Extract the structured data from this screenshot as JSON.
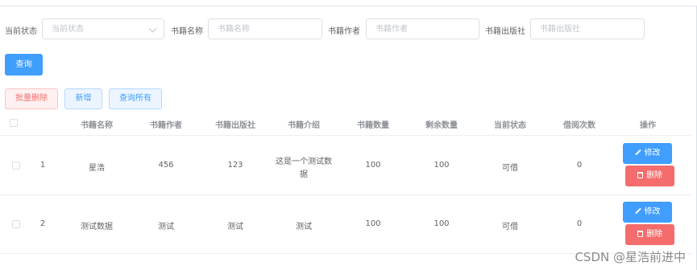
{
  "search": {
    "status_label": "当前状态",
    "status_placeholder": "当前状态",
    "name_label": "书籍名称",
    "name_placeholder": "书籍名称",
    "author_label": "书籍作者",
    "author_placeholder": "书籍作者",
    "publisher_label": "书籍出版社",
    "publisher_placeholder": "书籍出版社",
    "query_button": "查询"
  },
  "toolbar": {
    "batch_delete": "批量删除",
    "add": "新增",
    "query_all": "查询所有"
  },
  "table": {
    "headers": [
      "书籍名称",
      "书籍作者",
      "书籍出版社",
      "书籍介绍",
      "书籍数量",
      "剩余数量",
      "当前状态",
      "借阅次数",
      "操作"
    ],
    "rows": [
      {
        "index": "1",
        "name": "星浩",
        "author": "456",
        "publisher": "123",
        "intro_line1": "这是一个测试数",
        "intro_line2": "据",
        "quantity": "100",
        "remaining": "100",
        "status": "可借",
        "borrow_count": "0"
      },
      {
        "index": "2",
        "name": "测试数据",
        "author": "测试",
        "publisher": "测试",
        "intro_line1": "测试",
        "intro_line2": "",
        "quantity": "100",
        "remaining": "100",
        "status": "可借",
        "borrow_count": "0"
      }
    ],
    "edit_label": "修改",
    "delete_label": "删除"
  },
  "watermark": "CSDN @星浩前进中",
  "colors": {
    "primary": "#409eff",
    "danger": "#f56c6c",
    "border": "#dcdfe6"
  }
}
